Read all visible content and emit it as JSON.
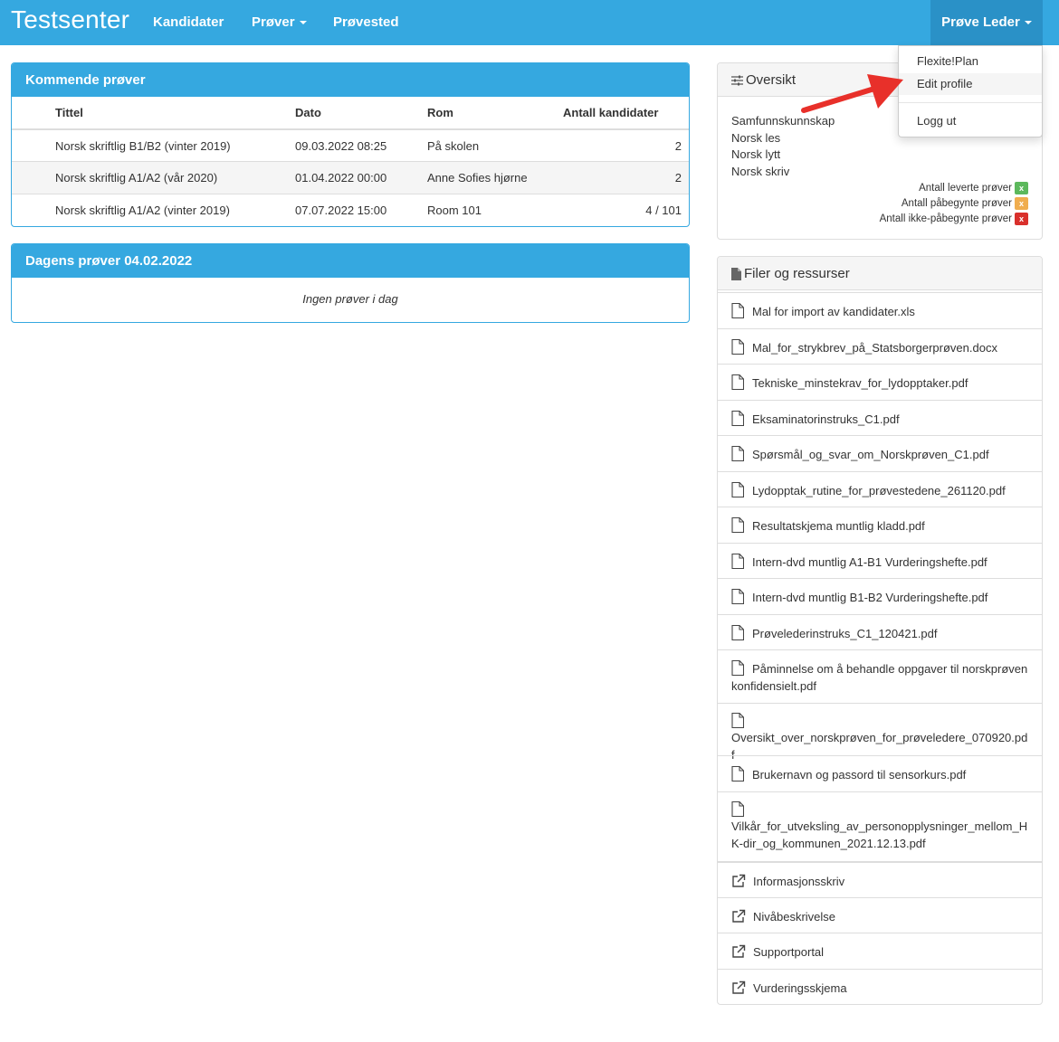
{
  "navbar": {
    "brand": "Testsenter",
    "items": [
      {
        "label": "Kandidater",
        "dropdown": false
      },
      {
        "label": "Prøver",
        "dropdown": true
      },
      {
        "label": "Prøvested",
        "dropdown": false
      }
    ],
    "user_menu": "Prøve Leder"
  },
  "user_dropdown": {
    "items": [
      "Flexite!Plan",
      "Edit profile",
      "Logg ut"
    ],
    "active": "Edit profile"
  },
  "upcoming": {
    "title": "Kommende prøver",
    "columns": [
      "Tittel",
      "Dato",
      "Rom",
      "Antall kandidater"
    ],
    "rows": [
      [
        "Norsk skriftlig B1/B2 (vinter 2019)",
        "09.03.2022 08:25",
        "På skolen",
        "2"
      ],
      [
        "Norsk skriftlig A1/A2 (vår 2020)",
        "01.04.2022 00:00",
        "Anne Sofies hjørne",
        "2"
      ],
      [
        "Norsk skriftlig A1/A2 (vinter 2019)",
        "07.07.2022 15:00",
        "Room 101",
        "4 / 101"
      ]
    ]
  },
  "today": {
    "title": "Dagens prøver 04.02.2022",
    "empty": "Ingen prøver i dag"
  },
  "oversikt": {
    "title": "Oversikt",
    "subjects": [
      "Samfunnskunnskap",
      "Norsk les",
      "Norsk lytt",
      "Norsk skriv"
    ],
    "legend": [
      {
        "label": "Antall leverte prøver",
        "badge": "x",
        "color": "#5cb85c"
      },
      {
        "label": "Antall påbegynte prøver",
        "badge": "x",
        "color": "#f0ad4e"
      },
      {
        "label": "Antall ikke-påbegynte prøver",
        "badge": "x",
        "color": "#d9302c"
      }
    ]
  },
  "files": {
    "title": "Filer og ressurser",
    "items": [
      {
        "label": "Mal for import av kandidater.xls",
        "icon": "file-icon"
      },
      {
        "label": "Mal_for_strykbrev_på_Statsborgerprøven.docx",
        "icon": "file-icon"
      },
      {
        "label": "Tekniske_minstekrav_for_lydopptaker.pdf",
        "icon": "file-icon"
      },
      {
        "label": "Eksaminatorinstruks_C1.pdf",
        "icon": "file-icon"
      },
      {
        "label": "Spørsmål_og_svar_om_Norskprøven_C1.pdf",
        "icon": "file-icon"
      },
      {
        "label": "Lydopptak_rutine_for_prøvestedene_261120.pdf",
        "icon": "file-icon"
      },
      {
        "label": "Resultatskjema muntlig kladd.pdf",
        "icon": "file-icon"
      },
      {
        "label": "Intern-dvd muntlig A1-B1 Vurderingshefte.pdf",
        "icon": "file-icon"
      },
      {
        "label": "Intern-dvd muntlig B1-B2 Vurderingshefte.pdf",
        "icon": "file-icon"
      },
      {
        "label": "Prøvelederinstruks_C1_120421.pdf",
        "icon": "file-icon"
      },
      {
        "label": "Påminnelse om å behandle oppgaver til norskprøven konfidensielt.pdf",
        "icon": "file-icon"
      },
      {
        "label": "Oversikt_over_norskprøven_for_prøveledere_070920.pdf",
        "icon": "file-icon"
      },
      {
        "label": "Brukernavn og passord til sensorkurs.pdf",
        "icon": "file-icon"
      },
      {
        "label": "Vilkår_for_utveksling_av_personopplysninger_mellom_HK-dir_og_kommunen_2021.12.13.pdf",
        "icon": "file-icon"
      },
      {
        "label": "Informasjonsskriv",
        "icon": "external-link-icon"
      },
      {
        "label": "Nivåbeskrivelse",
        "icon": "external-link-icon"
      },
      {
        "label": "Supportportal",
        "icon": "external-link-icon"
      },
      {
        "label": "Vurderingsskjema",
        "icon": "external-link-icon"
      }
    ]
  },
  "colors": {
    "primary": "#35a8e0",
    "primary_dark": "#2a91c7",
    "arrow": "#e8302a"
  }
}
